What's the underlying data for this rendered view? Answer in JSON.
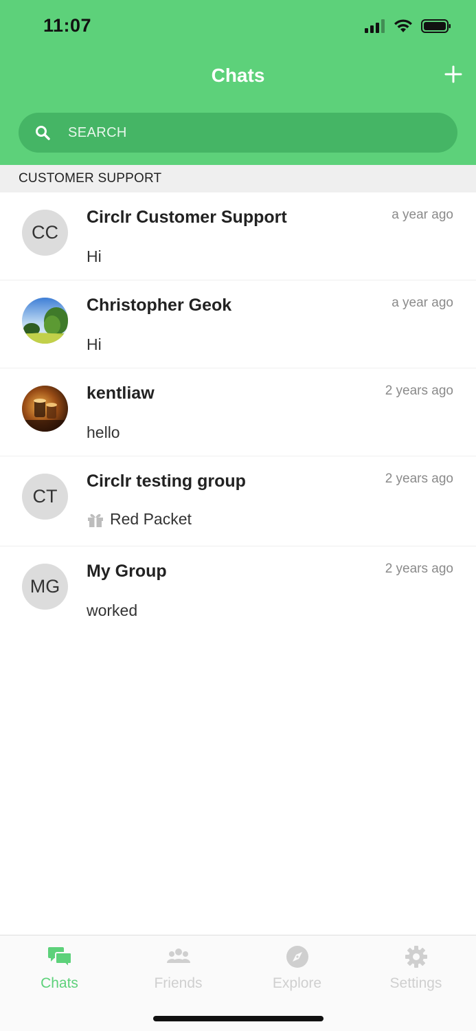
{
  "status_bar": {
    "time": "11:07"
  },
  "header": {
    "title": "Chats",
    "add_icon": "plus-icon"
  },
  "search": {
    "placeholder": "SEARCH",
    "icon": "search-icon"
  },
  "section": {
    "title": "CUSTOMER SUPPORT"
  },
  "chats": [
    {
      "initials": "CC",
      "avatar": "initials",
      "name": "Circlr Customer Support",
      "time": "a year ago",
      "message": "Hi"
    },
    {
      "initials": "",
      "avatar": "photo-landscape",
      "name": "Christopher Geok",
      "time": "a year ago",
      "message": "Hi"
    },
    {
      "initials": "",
      "avatar": "photo-glasses",
      "name": "kentliaw",
      "time": "2 years ago",
      "message": "hello"
    },
    {
      "initials": "CT",
      "avatar": "initials",
      "name": "Circlr testing group",
      "time": "2 years ago",
      "message": "Red Packet",
      "message_icon": "gift-icon"
    },
    {
      "initials": "MG",
      "avatar": "initials",
      "name": "My Group",
      "time": "2 years ago",
      "message": "worked"
    }
  ],
  "tabs": [
    {
      "label": "Chats",
      "icon": "chat-bubbles-icon",
      "active": true
    },
    {
      "label": "Friends",
      "icon": "friends-icon",
      "active": false
    },
    {
      "label": "Explore",
      "icon": "compass-icon",
      "active": false
    },
    {
      "label": "Settings",
      "icon": "gear-icon",
      "active": false
    }
  ],
  "colors": {
    "accent": "#5dd17a",
    "search_bg": "#45b565",
    "inactive": "#cfcfcf"
  }
}
